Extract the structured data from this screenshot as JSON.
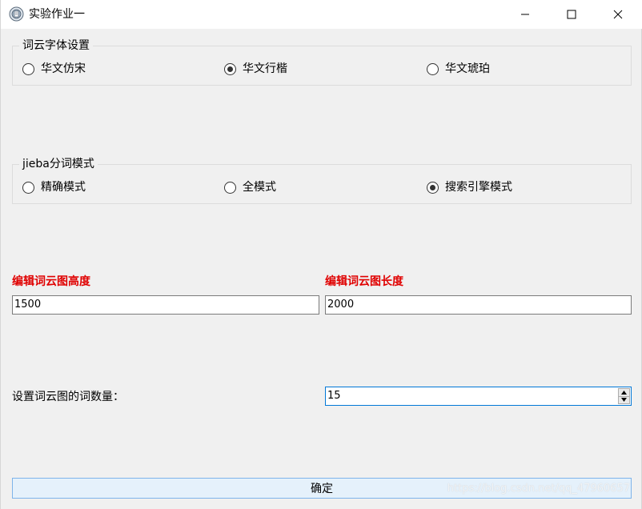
{
  "window": {
    "title": "实验作业一",
    "icon": "app-icon",
    "controls": [
      "minimize-icon",
      "maximize-icon",
      "close-icon"
    ]
  },
  "font_group": {
    "title": "词云字体设置",
    "options": [
      {
        "label": "华文仿宋",
        "checked": false
      },
      {
        "label": "华文行楷",
        "checked": true
      },
      {
        "label": "华文琥珀",
        "checked": false
      }
    ]
  },
  "mode_group": {
    "title": "jieba分词模式",
    "options": [
      {
        "label": "精确模式",
        "checked": false
      },
      {
        "label": "全模式",
        "checked": false
      },
      {
        "label": "搜索引擎模式",
        "checked": true
      }
    ]
  },
  "height": {
    "label": "编辑词云图高度",
    "value": "1500"
  },
  "width": {
    "label": "编辑词云图长度",
    "value": "2000"
  },
  "word_count": {
    "label": "设置词云图的词数量：",
    "value": "15"
  },
  "confirm_button": {
    "label": "确定"
  },
  "watermark": "https://blog.csdn.net/qq_47960657",
  "colors": {
    "label_red": "#e00000",
    "focus_blue": "#0078d7",
    "button_bg": "#e5f1fb"
  }
}
